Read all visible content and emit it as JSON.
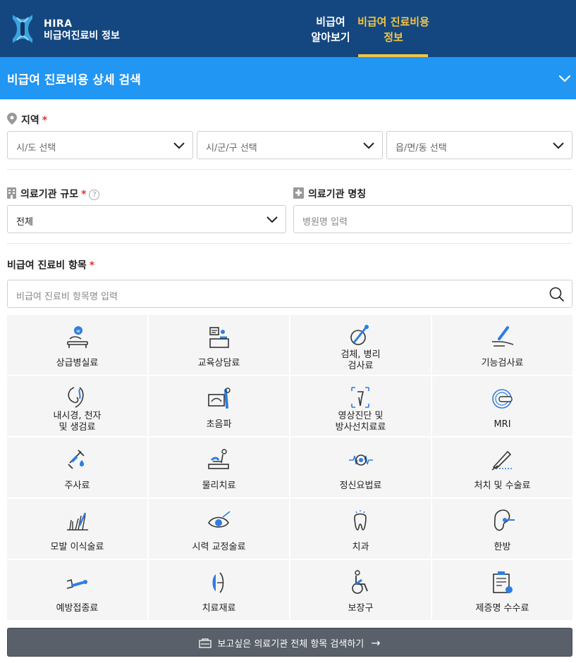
{
  "header": {
    "brand_line1": "HIRA",
    "brand_line2": "비급여진료비 정보",
    "nav": [
      {
        "line1": "비급여",
        "line2": "알아보기"
      },
      {
        "line1": "비급여 진료비용",
        "line2": "정보"
      }
    ],
    "colors": {
      "bg": "#14477f",
      "active": "#f6c543"
    }
  },
  "search_panel": {
    "title": "비급여 진료비용 상세 검색",
    "color": "#2196f3"
  },
  "region": {
    "label": "지역",
    "required_mark": "*",
    "selects": [
      "시/도 선택",
      "시/군/구 선택",
      "읍/면/동 선택"
    ]
  },
  "institution": {
    "scale_label": "의료기관 규모",
    "required_mark": "*",
    "help_mark": "?",
    "scale_value": "전체",
    "name_label": "의료기관 명칭",
    "name_placeholder": "병원명 입력"
  },
  "items": {
    "label": "비급여 진료비 항목",
    "required_mark": "*",
    "search_placeholder": "비급여 진료비 항목명 입력",
    "categories": [
      {
        "name": "상급병실료",
        "icon": "hospital-bed-icon"
      },
      {
        "name": "교육상담료",
        "icon": "counseling-desk-icon"
      },
      {
        "name": "검체, 병리\n검사료",
        "icon": "microscope-sample-icon"
      },
      {
        "name": "기능검사료",
        "icon": "hand-test-icon"
      },
      {
        "name": "내시경, 천자\n및 생검료",
        "icon": "endoscope-icon"
      },
      {
        "name": "초음파",
        "icon": "ultrasound-icon"
      },
      {
        "name": "영상진단 및\n방사선치료료",
        "icon": "xray-icon"
      },
      {
        "name": "MRI",
        "icon": "mri-icon"
      },
      {
        "name": "주사료",
        "icon": "syringe-icon"
      },
      {
        "name": "물리치료",
        "icon": "physical-therapy-icon"
      },
      {
        "name": "정신요법료",
        "icon": "brain-wave-icon"
      },
      {
        "name": "처치 및 수술료",
        "icon": "scalpel-icon"
      },
      {
        "name": "모발 이식술료",
        "icon": "hair-transplant-icon"
      },
      {
        "name": "시력 교정술료",
        "icon": "eye-laser-icon"
      },
      {
        "name": "치과",
        "icon": "tooth-icon"
      },
      {
        "name": "한방",
        "icon": "ear-acupuncture-icon"
      },
      {
        "name": "예방접종료",
        "icon": "vaccination-icon"
      },
      {
        "name": "치료재료",
        "icon": "lens-material-icon"
      },
      {
        "name": "보장구",
        "icon": "wheelchair-icon"
      },
      {
        "name": "제증명 수수료",
        "icon": "certificate-icon"
      }
    ]
  },
  "bottom_button": {
    "label": "보고싶은 의료기관 전체 항목 검색하기",
    "arrow": "→"
  }
}
